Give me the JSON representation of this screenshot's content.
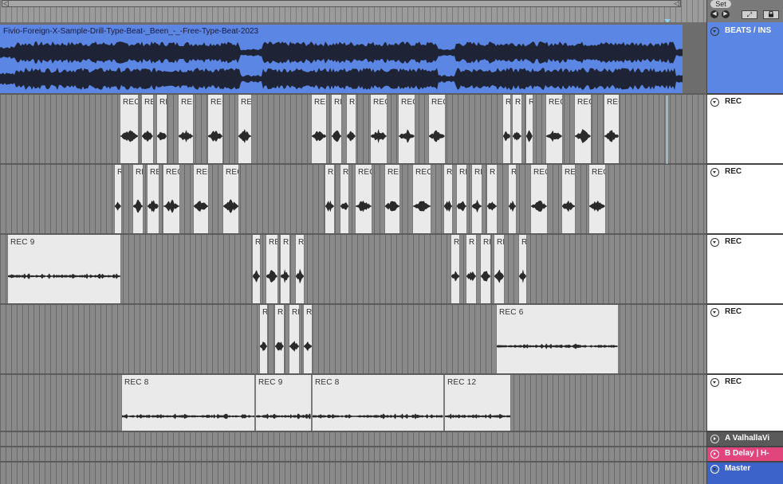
{
  "scrollbar": {
    "left_arrow": "◁",
    "right_arrow": "◁"
  },
  "header": {
    "set_label": "Set",
    "expand_icon": "⤢",
    "lock_icon": "lock-icon"
  },
  "beats_clip": {
    "title": "Fivio-Foreign-X-Sample-Drill-Type-Beat-_Been_-_-Free-Type-Beat-2023"
  },
  "tracks": [
    {
      "name": "BEATS / INS",
      "color": "#5b86e3"
    },
    {
      "name": "REC"
    },
    {
      "name": "REC"
    },
    {
      "name": "REC"
    },
    {
      "name": "REC"
    },
    {
      "name": "REC"
    },
    {
      "name": "A ValhallaVi",
      "color": "#5a5a5a"
    },
    {
      "name": "B Delay | H-",
      "color": "#e0457b"
    },
    {
      "name": "Master",
      "color": "#3c63c9"
    }
  ],
  "lane1_labels": [
    "REC",
    "REC",
    "REC",
    "REC",
    "REC",
    "REC",
    "REC",
    "REC",
    "REC",
    "REC",
    "REC",
    "REC",
    "REC",
    "REC",
    "REC",
    "REC",
    "REC",
    "REC"
  ],
  "lane2_labels": [
    "R",
    "RE",
    "RE",
    "REC",
    "REC",
    "REC",
    "RE",
    "RE",
    "REC",
    "REC",
    "REC",
    "RE",
    "RE",
    "RE",
    "R",
    "R",
    "REC",
    "REC",
    "REC"
  ],
  "lane3_labels": [
    "REC 9",
    "R",
    "RE",
    "RE",
    "RE",
    "R",
    "R",
    "RE",
    "RE",
    "RE"
  ],
  "lane4_labels": [
    "R",
    "R",
    "RE",
    "RE",
    "REC 6"
  ],
  "lane5_labels": [
    "REC 8",
    "REC 9",
    "REC 8",
    "REC 12"
  ]
}
